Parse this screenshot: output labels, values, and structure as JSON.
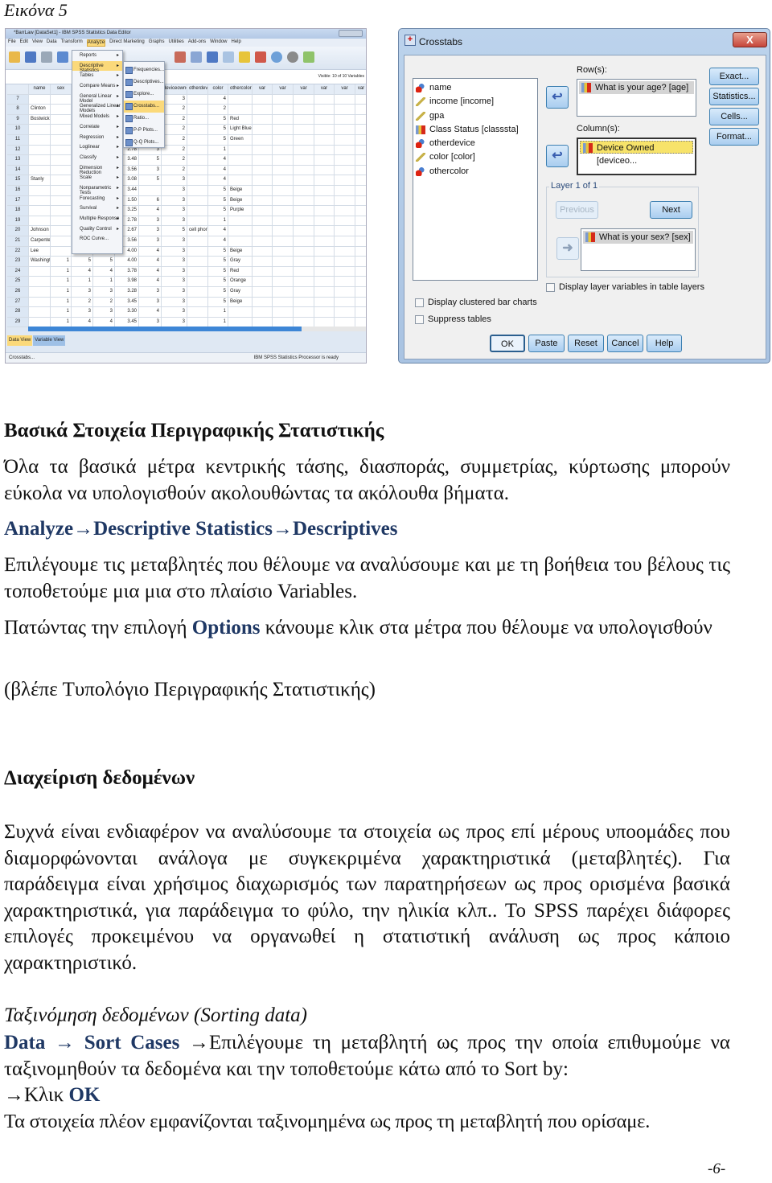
{
  "caption": "Εικόνα 5",
  "spss_editor": {
    "title": "*BarrLaw [DataSet1] - IBM SPSS Statistics Data Editor",
    "menubar": [
      "File",
      "Edit",
      "View",
      "Data",
      "Transform",
      "Analyze",
      "Direct Marketing",
      "Graphs",
      "Utilities",
      "Add-ons",
      "Window",
      "Help"
    ],
    "active_menu": "Analyze",
    "visible_vars": "Visible: 10 of 10 Variables",
    "columns": [
      "name",
      "sex",
      "",
      "",
      "",
      "",
      "deviceowned",
      "otherdevice",
      "color",
      "othercolor",
      "var",
      "var",
      "var",
      "var",
      "var",
      "var"
    ],
    "rows": [
      [
        "7",
        "",
        "",
        "",
        "",
        "",
        "",
        "3",
        "",
        "4",
        ""
      ],
      [
        "8",
        "Clinton",
        "",
        "",
        "",
        "",
        "",
        "2",
        "",
        "2",
        ""
      ],
      [
        "9",
        "Bostwick",
        "",
        "",
        "",
        "",
        "",
        "2",
        "",
        "5",
        "Red"
      ],
      [
        "10",
        "",
        "",
        "",
        "",
        "",
        "",
        "2",
        "",
        "5",
        "Light Blue"
      ],
      [
        "11",
        "",
        "",
        "",
        "",
        "",
        "",
        "2",
        "",
        "5",
        "Green"
      ],
      [
        "12",
        "",
        "",
        "",
        "",
        "2.78",
        "3",
        "2",
        "",
        "1",
        ""
      ],
      [
        "13",
        "",
        "",
        "",
        "",
        "3.48",
        "5",
        "2",
        "",
        "4",
        ""
      ],
      [
        "14",
        "",
        "",
        "",
        "",
        "3.56",
        "3",
        "2",
        "",
        "4",
        ""
      ],
      [
        "15",
        "Stanly",
        "",
        "",
        "",
        "3.08",
        "5",
        "3",
        "",
        "4",
        ""
      ],
      [
        "16",
        "",
        "",
        "",
        "",
        "3.44",
        "",
        "3",
        "",
        "5",
        "Beige"
      ],
      [
        "17",
        "",
        "",
        "",
        "",
        "1.50",
        "6",
        "3",
        "",
        "5",
        "Beige"
      ],
      [
        "18",
        "",
        "",
        "",
        "",
        "3.25",
        "4",
        "3",
        "",
        "5",
        "Purple"
      ],
      [
        "19",
        "",
        "",
        "",
        "",
        "2.78",
        "3",
        "3",
        "",
        "1",
        ""
      ],
      [
        "20",
        "Johnson",
        "",
        "",
        "",
        "2.67",
        "3",
        "5",
        "cell phone ...",
        "4",
        ""
      ],
      [
        "21",
        "Carpente",
        "",
        "",
        "",
        "3.56",
        "3",
        "3",
        "",
        "4",
        ""
      ],
      [
        "22",
        "Lee",
        "",
        "",
        "",
        "4.00",
        "4",
        "3",
        "",
        "5",
        "Beige"
      ],
      [
        "23",
        "Washingt",
        "1",
        "5",
        "5",
        "4.00",
        "4",
        "3",
        "",
        "5",
        "Gray"
      ],
      [
        "24",
        "",
        "1",
        "4",
        "4",
        "3.78",
        "4",
        "3",
        "",
        "5",
        "Red"
      ],
      [
        "25",
        "",
        "1",
        "1",
        "1",
        "3.98",
        "4",
        "3",
        "",
        "5",
        "Orange"
      ],
      [
        "26",
        "",
        "1",
        "3",
        "3",
        "3.28",
        "3",
        "3",
        "",
        "5",
        "Gray"
      ],
      [
        "27",
        "",
        "1",
        "2",
        "2",
        "3.45",
        "3",
        "3",
        "",
        "5",
        "Beige"
      ],
      [
        "28",
        "",
        "1",
        "3",
        "3",
        "3.30",
        "4",
        "3",
        "",
        "1",
        ""
      ],
      [
        "29",
        "",
        "1",
        "4",
        "4",
        "3.45",
        "3",
        "3",
        "",
        "1",
        ""
      ]
    ],
    "analyze_menu": [
      "Reports",
      "Descriptive Statistics",
      "Tables",
      "Compare Means",
      "General Linear Model",
      "Generalized Linear Models",
      "Mixed Models",
      "Correlate",
      "Regression",
      "Loglinear",
      "Classify",
      "Dimension Reduction",
      "Scale",
      "Nonparametric Tests",
      "Forecasting",
      "Survival",
      "Multiple Response",
      "Quality Control",
      "ROC Curve..."
    ],
    "descriptive_submenu": [
      "Frequencies...",
      "Descriptives...",
      "Explore...",
      "Crosstabs...",
      "Ratio...",
      "P-P Plots...",
      "Q-Q Plots..."
    ],
    "tabs": [
      "Data View",
      "Variable View"
    ],
    "status_left": "Crosstabs...",
    "status_right": "IBM SPSS Statistics Processor is ready"
  },
  "crosstabs": {
    "title": "Crosstabs",
    "close": "X",
    "variables": [
      {
        "label": "name",
        "type": "nominal"
      },
      {
        "label": "income [income]",
        "type": "scale"
      },
      {
        "label": "gpa",
        "type": "scale"
      },
      {
        "label": "Class Status [classsta]",
        "type": "ordinal"
      },
      {
        "label": "otherdevice",
        "type": "nominal"
      },
      {
        "label": "color [color]",
        "type": "scale"
      },
      {
        "label": "othercolor",
        "type": "nominal"
      }
    ],
    "rows_label": "Row(s):",
    "rows_item": "What is your age? [age]",
    "columns_label": "Column(s):",
    "columns_item": "Device Owned [deviceo...",
    "layer_legend": "Layer 1 of 1",
    "previous": "Previous",
    "next": "Next",
    "layer_item": "What is your sex? [sex]",
    "side_buttons": [
      "Exact...",
      "Statistics...",
      "Cells...",
      "Format..."
    ],
    "display_layer": "Display layer variables in table layers",
    "clustered": "Display clustered bar charts",
    "suppress": "Suppress tables",
    "bottom_buttons": [
      "OK",
      "Paste",
      "Reset",
      "Cancel",
      "Help"
    ]
  },
  "section1": {
    "heading": "Βασικά Στοιχεία Περιγραφικής Στατιστικής",
    "intro": "Όλα τα βασικά μέτρα κεντρικής τάσης, διασποράς, συμμετρίας, κύρτωσης μπορούν εύκολα να υπολογισθούν ακολουθώντας τα ακόλουθα βήματα.",
    "path": "Analyze→Descriptive Statistics→Descriptives",
    "select_text": "Επιλέγουμε τις μεταβλητές που θέλουμε να αναλύσουμε και με τη βοήθεια του βέλους τις τοποθετούμε μια μια στο πλαίσιο Variables.",
    "options_before": "Πατώντας την επιλογή ",
    "options_label": "Options",
    "options_after": " κάνουμε κλικ στα μέτρα που θέλουμε να υπολογισθούν",
    "see_also": "(βλέπε Τυπολόγιο Περιγραφικής Στατιστικής)"
  },
  "section2": {
    "heading": "Διαχείριση δεδομένων",
    "body": "Συχνά είναι ενδιαφέρον να αναλύσουμε τα στοιχεία ως προς επί μέρους υποομάδες που διαμορφώνονται ανάλογα με συγκεκριμένα χαρακτηριστικά (μεταβλητές). Για παράδειγμα είναι χρήσιμος διαχωρισμός των παρατηρήσεων ως προς ορισμένα βασικά χαρακτηριστικά, για παράδειγμα το φύλο, την ηλικία κλπ.. Το SPSS παρέχει διάφορες επιλογές προκειμένου να οργανωθεί η στατιστική ανάλυση ως προς κάποιο χαρακτηριστικό.",
    "sorting_title": "Ταξινόμηση δεδομένων (Sorting data)",
    "sort_path": "Data → Sort Cases ",
    "sort_text": "→Επιλέγουμε τη μεταβλητή ως προς την οποία επιθυμούμε να ταξινομηθούν τα δεδομένα και την τοποθετούμε κάτω από το Sort by:",
    "click_prefix": "→Κλικ ",
    "click_ok": "OK",
    "result": "Τα στοιχεία πλέον εμφανίζονται ταξινομημένα ως προς τη μεταβλητή που ορίσαμε."
  },
  "page_number": "-6-",
  "colors": {
    "accent_navy": "#1f3864",
    "menu_highlight": "#fbd97a",
    "dialog_blue": "#a9c3e2"
  }
}
